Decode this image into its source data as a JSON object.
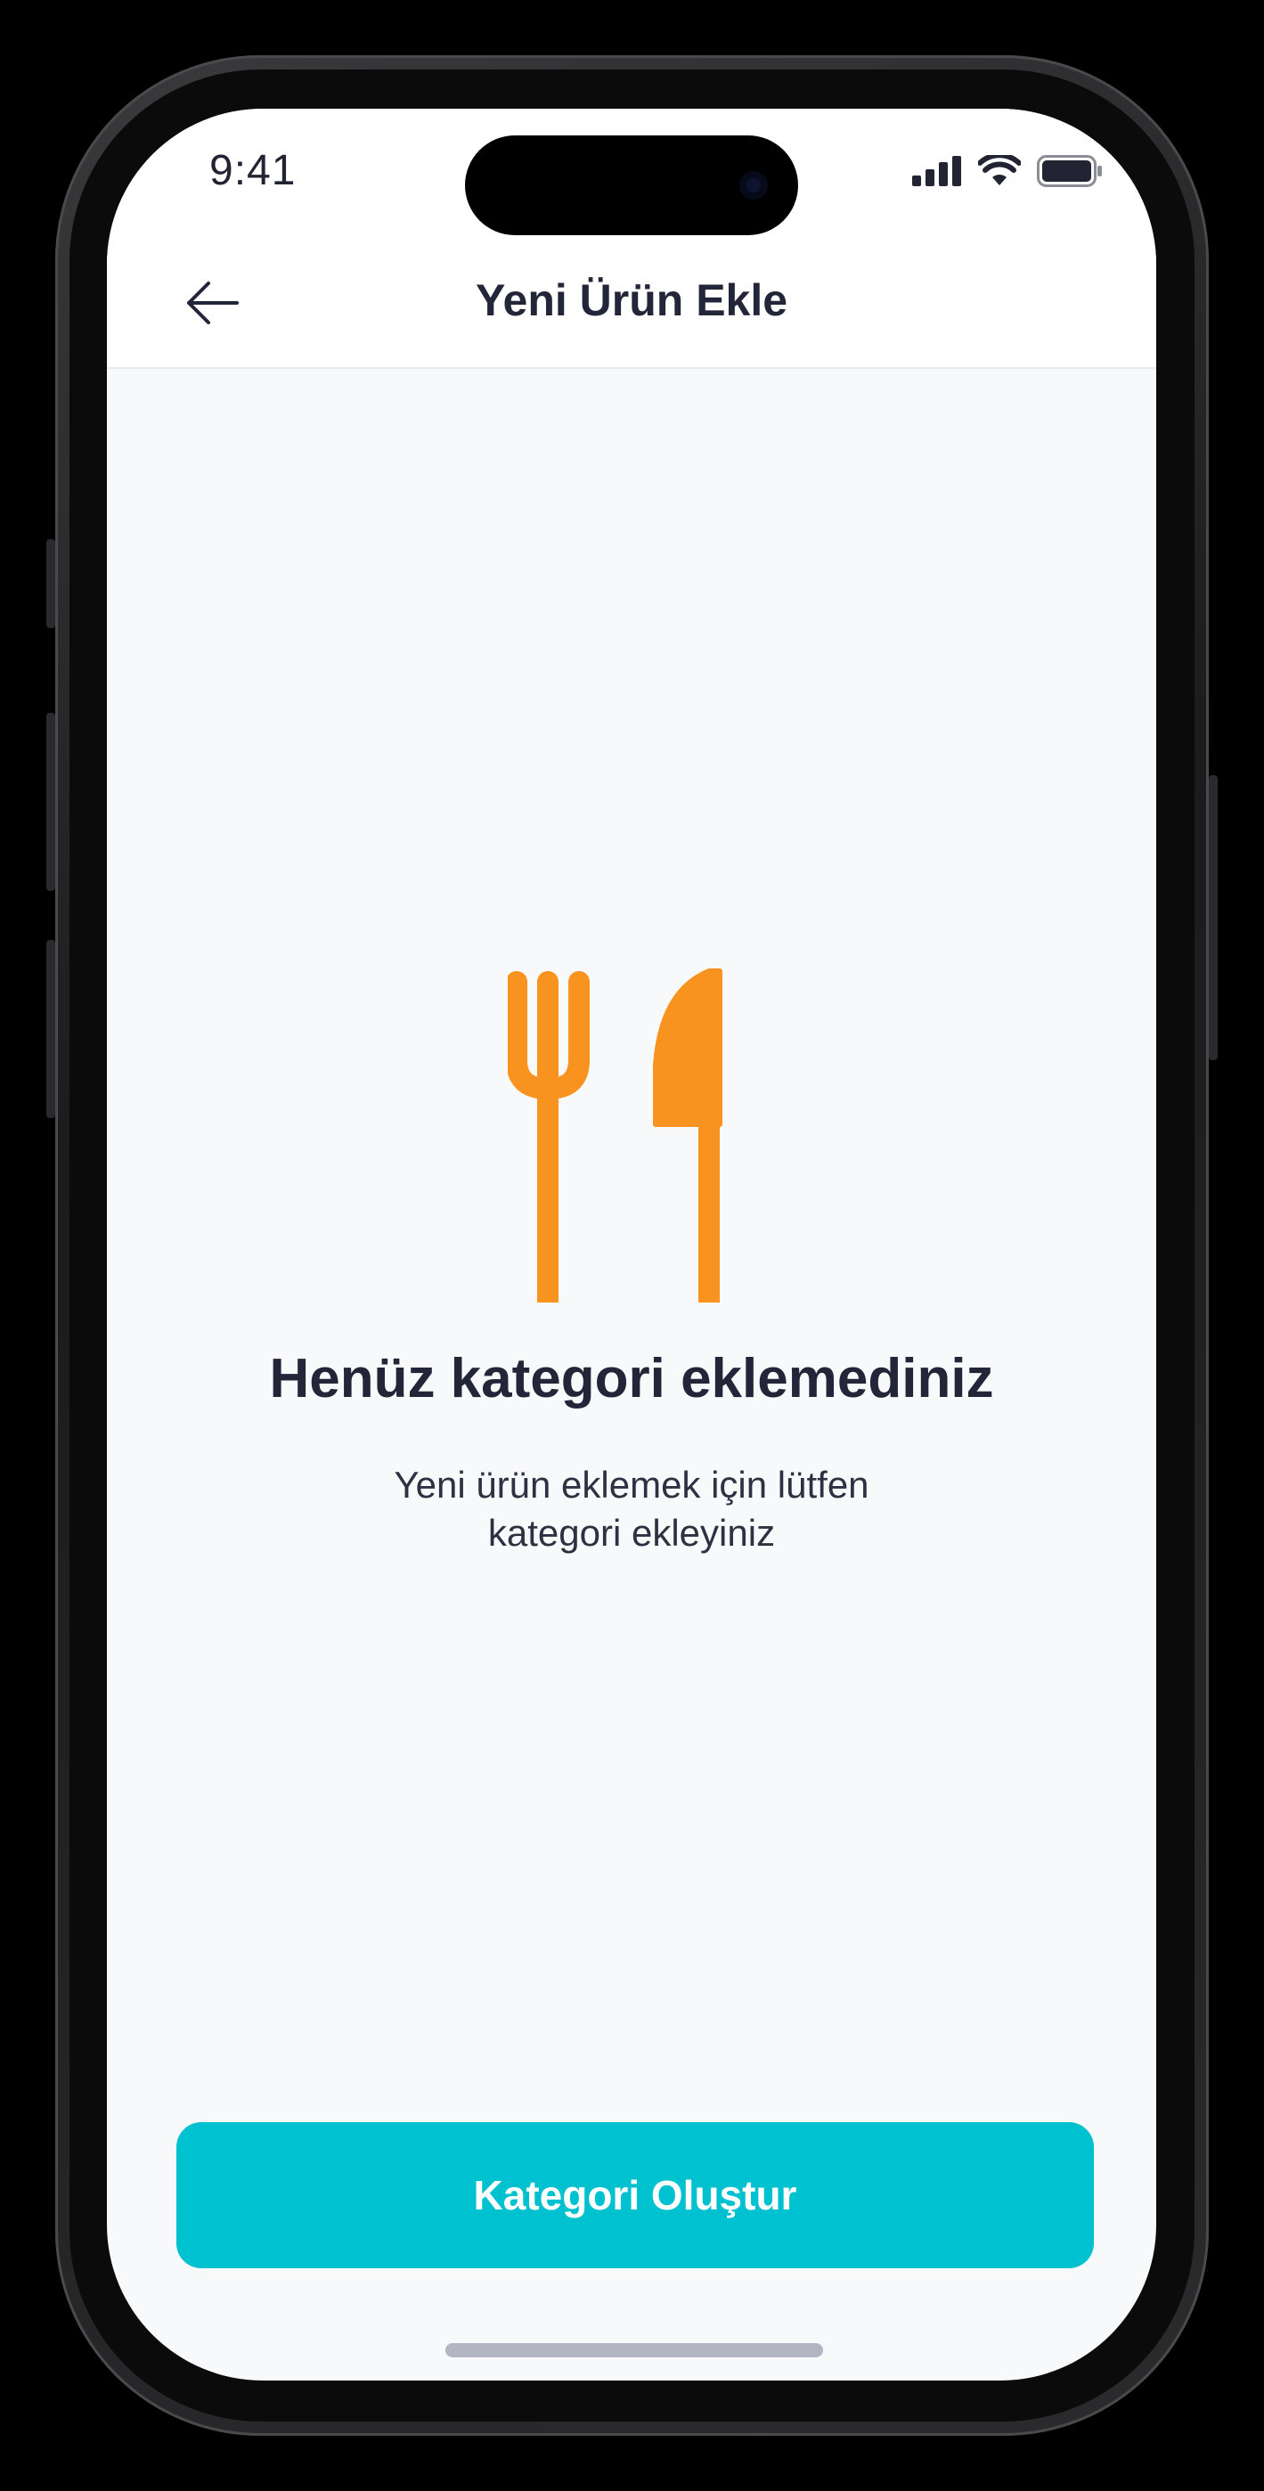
{
  "status_bar": {
    "time": "9:41",
    "icons": [
      "cellular-signal-icon",
      "wifi-icon",
      "battery-icon"
    ]
  },
  "header": {
    "back_icon": "arrow-left-icon",
    "title": "Yeni Ürün Ekle"
  },
  "empty_state": {
    "icon": "fork-knife-icon",
    "title": "Henüz kategori eklemediniz",
    "subtitle_line1": "Yeni ürün eklemek için lütfen",
    "subtitle_line2": "kategori ekleyiniz"
  },
  "primary_action": {
    "label": "Kategori Oluştur"
  },
  "colors": {
    "accent": "#00c1cf",
    "icon": "#f7931e",
    "text_primary": "#232538",
    "background": "#f8f9fb"
  }
}
